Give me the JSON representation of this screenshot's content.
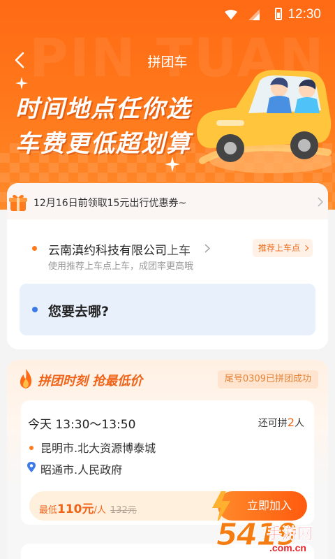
{
  "status_bar": {
    "time": "12:30"
  },
  "nav": {
    "title": "拼团车",
    "watermark": "PIN TUAN"
  },
  "banner": {
    "line1": "时间地点任你选",
    "line2": "车费更低超划算"
  },
  "coupon": {
    "text": "12月16日前领取15元出行优惠券~"
  },
  "pickup": {
    "name": "云南滇约科技有限公司",
    "suffix": "上车",
    "hint": "使用推荐上车点上车，成团率更高哦",
    "recommend_label": "推荐上车点"
  },
  "destination": {
    "placeholder": "您要去哪?"
  },
  "group": {
    "title": "拼团时刻 抢最低价",
    "success_badge": "尾号0309已拼团成功",
    "trip": {
      "time": "今天 13:30～13:50",
      "seats_prefix": "还可拼",
      "seats_num": "2",
      "seats_suffix": "人",
      "from": "昆明市.北大资源博泰城",
      "to": "昭通市.人民政府",
      "price_prefix": "最低",
      "price": "110元",
      "price_unit": "/人",
      "original_price": "132元",
      "join_label": "立即加入"
    }
  },
  "site_logo": {
    "digits": "5419",
    "cn": "手游网",
    "url": ".com.cn"
  },
  "colors": {
    "brand_orange": "#ff6a14",
    "accent_blue": "#3b7ae8",
    "dest_bg": "#e8f0fb"
  }
}
